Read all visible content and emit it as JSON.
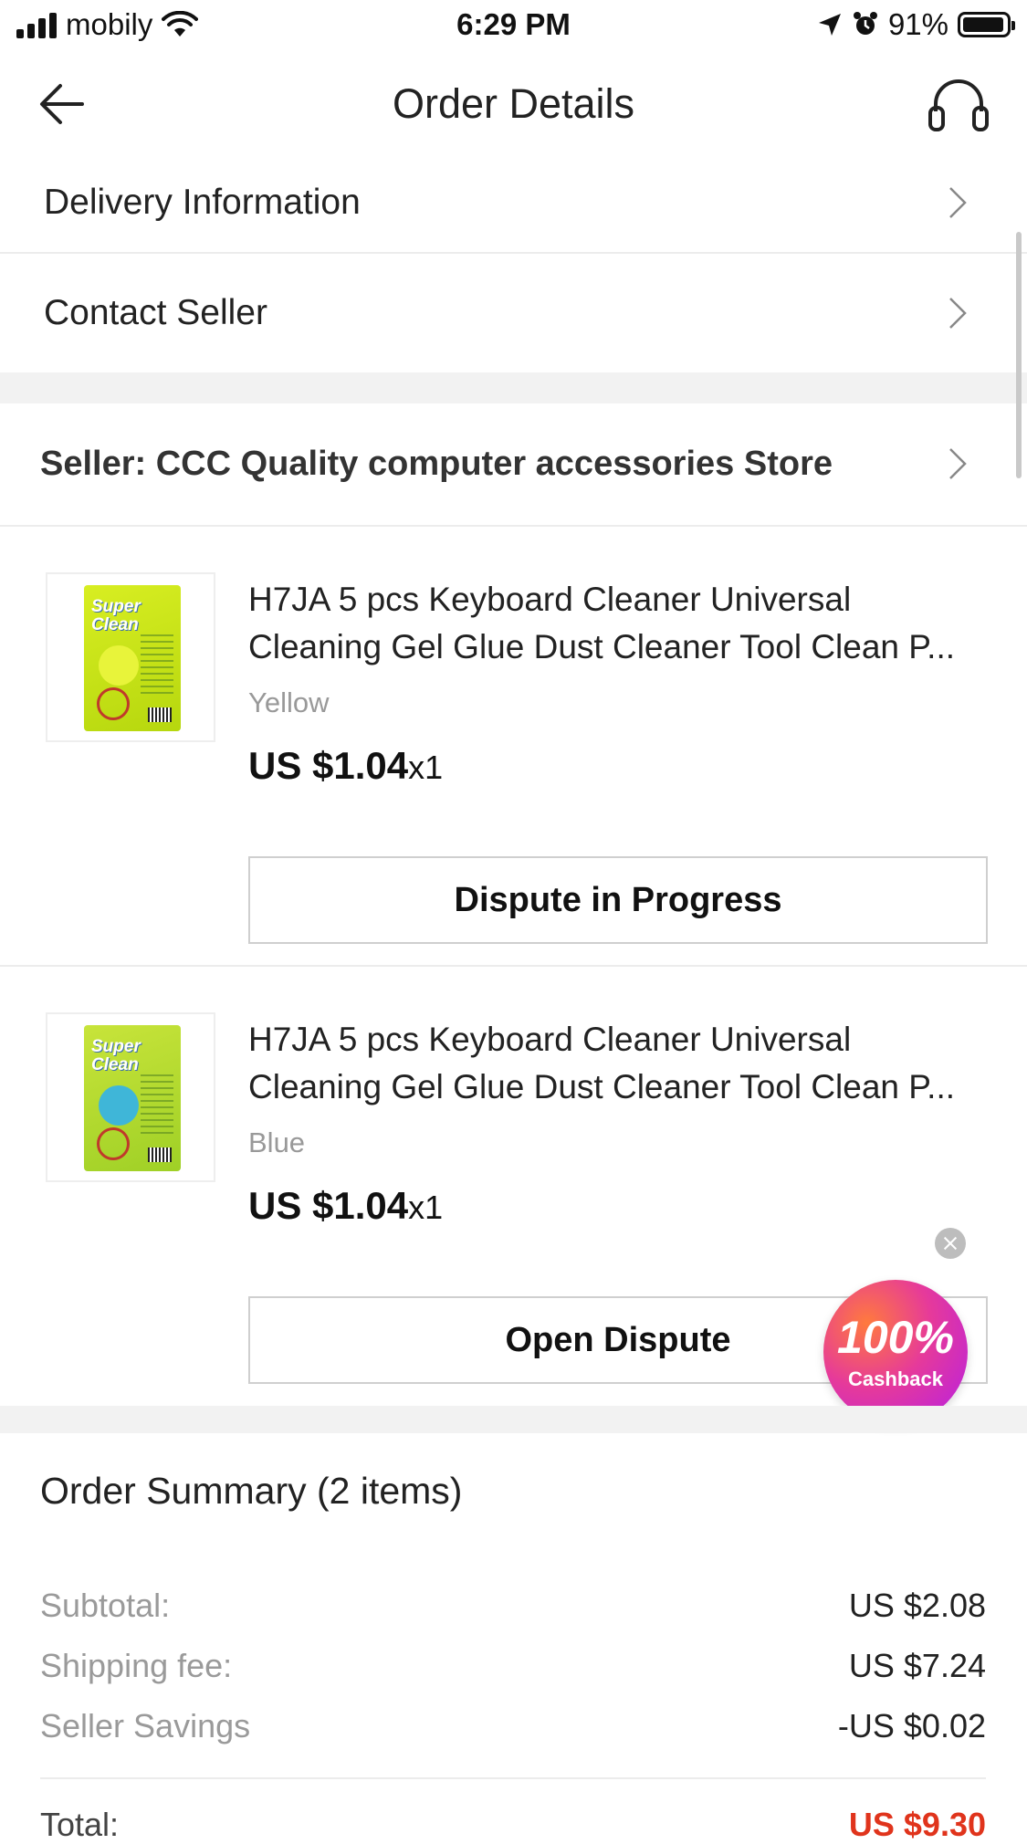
{
  "status_bar": {
    "carrier": "mobily",
    "time": "6:29 PM",
    "battery": "91%"
  },
  "header": {
    "title": "Order Details",
    "icons": [
      "back-arrow-icon",
      "headset-support-icon"
    ]
  },
  "links": {
    "delivery": "Delivery Information",
    "contact": "Contact Seller"
  },
  "seller": {
    "label": "Seller: CCC Quality computer accessories Store"
  },
  "items": [
    {
      "name_line1": "H7JA 5 pcs Keyboard Cleaner Universal",
      "name_line2": "Cleaning Gel Glue Dust Cleaner Tool Clean P...",
      "variant": "Yellow",
      "price": "US $1.04",
      "qty": "x1",
      "button": "Dispute in Progress",
      "pack_text": "Super Clean"
    },
    {
      "name_line1": "H7JA 5 pcs Keyboard Cleaner Universal",
      "name_line2": "Cleaning Gel Glue Dust Cleaner Tool Clean P...",
      "variant": "Blue",
      "price": "US $1.04",
      "qty": "x1",
      "button": "Open Dispute",
      "pack_text": "Super Clean"
    }
  ],
  "cashback": {
    "percent": "100%",
    "label": "Cashback"
  },
  "summary": {
    "title": "Order Summary (2 items)",
    "rows": [
      {
        "label": "Subtotal:",
        "value": "US $2.08"
      },
      {
        "label": "Shipping fee:",
        "value": "US $7.24"
      },
      {
        "label": "Seller Savings",
        "value": "-US $0.02"
      }
    ],
    "total_label": "Total:",
    "total_value": "US $9.30"
  },
  "colors": {
    "accent_red": "#e0341c",
    "divider": "#ececec",
    "section_gray": "#f2f2f2"
  }
}
